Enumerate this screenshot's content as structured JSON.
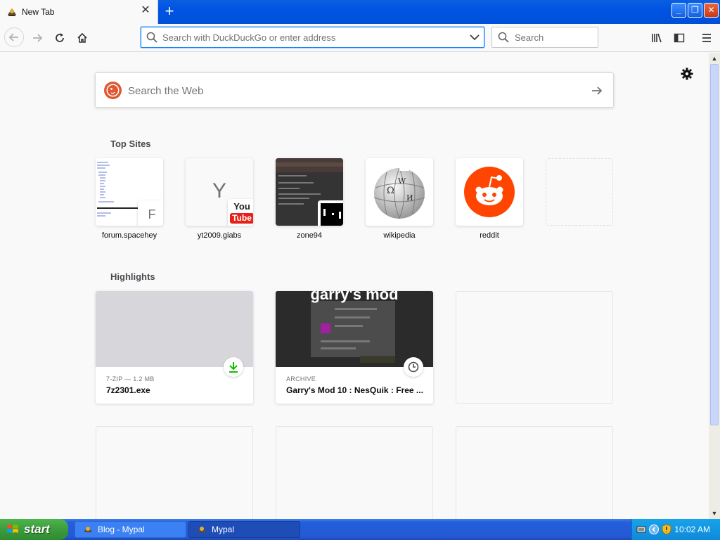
{
  "browser": {
    "tab": {
      "title": "New Tab",
      "close": "✕"
    },
    "new_tab": "+",
    "window_buttons": {
      "minimize": "_",
      "restore": "❐",
      "close": "✕"
    },
    "urlbar": {
      "placeholder": "Search with DuckDuckGo or enter address"
    },
    "searchbar": {
      "placeholder": "Search"
    }
  },
  "newtab": {
    "websearch": {
      "placeholder": "Search the Web"
    },
    "top_sites_heading": "Top Sites",
    "top_sites": [
      {
        "label": "forum.spacehey",
        "fallback_letter": "F"
      },
      {
        "label": "yt2009.giabs",
        "letter": "Y",
        "badge_top": "You",
        "badge_bottom": "Tube"
      },
      {
        "label": "zone94"
      },
      {
        "label": "wikipedia"
      },
      {
        "label": "reddit"
      },
      {
        "label": ""
      }
    ],
    "highlights_heading": "Highlights",
    "highlights": [
      {
        "context": "7-ZIP — 1.2 MB",
        "title": "7z2301.exe",
        "badge": "download-icon"
      },
      {
        "context": "ARCHIVE",
        "title": "Garry's Mod 10 : NesQuik : Free ...",
        "badge": "clock-icon",
        "thumb_text": "garry's mod"
      }
    ]
  },
  "taskbar": {
    "start_label": "start",
    "tasks": [
      {
        "label": "Blog - Mypal",
        "active": false
      },
      {
        "label": "Mypal",
        "active": true
      }
    ],
    "clock": "10:02 AM"
  },
  "colors": {
    "accent": "#0a84ff",
    "xp_blue": "#245edb",
    "start_green": "#3c9c3c",
    "reddit": "#ff4500",
    "download_green": "#12bc00"
  }
}
